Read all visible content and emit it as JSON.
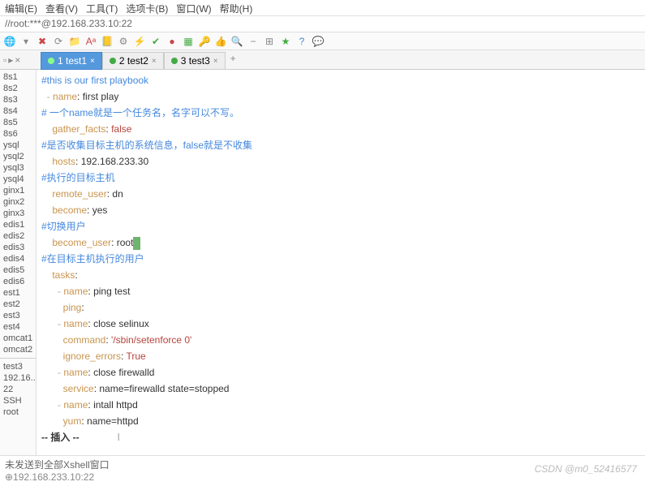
{
  "menubar": [
    "编辑(E)",
    "查看(V)",
    "工具(T)",
    "选项卡(B)",
    "窗口(W)",
    "帮助(H)"
  ],
  "address": "//root:***@192.168.233.10:22",
  "toolbar_icons": [
    {
      "name": "globe-icon",
      "glyph": "🌐",
      "color": "#4a4"
    },
    {
      "name": "dropdown-icon",
      "glyph": "▾",
      "color": "#888"
    },
    {
      "name": "x-icon",
      "glyph": "✖",
      "color": "#c44"
    },
    {
      "name": "refresh-icon",
      "glyph": "⟳",
      "color": "#888"
    },
    {
      "name": "folder-icon",
      "glyph": "📁",
      "color": "#c90"
    },
    {
      "name": "font-icon",
      "glyph": "Aᵃ",
      "color": "#c44"
    },
    {
      "name": "ledger-icon",
      "glyph": "📒",
      "color": "#888"
    },
    {
      "name": "gear-icon",
      "glyph": "⚙",
      "color": "#888"
    },
    {
      "name": "bolt-icon",
      "glyph": "⚡",
      "color": "#c90"
    },
    {
      "name": "check-icon",
      "glyph": "✔",
      "color": "#4a4"
    },
    {
      "name": "circle-icon",
      "glyph": "●",
      "color": "#c44"
    },
    {
      "name": "squares-icon",
      "glyph": "▦",
      "color": "#4a4"
    },
    {
      "name": "key-icon",
      "glyph": "🔑",
      "color": "#c90"
    },
    {
      "name": "thumb-icon",
      "glyph": "👍",
      "color": "#888"
    },
    {
      "name": "search-icon",
      "glyph": "🔍",
      "color": "#888"
    },
    {
      "name": "minus-icon",
      "glyph": "−",
      "color": "#888"
    },
    {
      "name": "grid-icon",
      "glyph": "⊞",
      "color": "#888"
    },
    {
      "name": "star-icon",
      "glyph": "★",
      "color": "#4a4"
    },
    {
      "name": "help-icon",
      "glyph": "?",
      "color": "#48c"
    },
    {
      "name": "chat-icon",
      "glyph": "💬",
      "color": "#888"
    }
  ],
  "tabs": [
    {
      "num": "1",
      "label": "test1",
      "active": true
    },
    {
      "num": "2",
      "label": "test2",
      "active": false
    },
    {
      "num": "3",
      "label": "test3",
      "active": false
    }
  ],
  "sidebar_top": [
    "8s1",
    "8s2",
    "8s3",
    "8s4",
    "8s5",
    "8s6",
    "ysql",
    "ysql2",
    "ysql3",
    "ysql4",
    "ginx1",
    "ginx2",
    "ginx3",
    "edis1",
    "edis2",
    "edis3",
    "edis4",
    "edis5",
    "edis6",
    "est1",
    "est2",
    "est3",
    "est4",
    "omcat1",
    "omcat2"
  ],
  "sidebar_bottom": [
    "test3",
    "192.16...",
    "22",
    "SSH",
    "root"
  ],
  "code": [
    {
      "t": "cm",
      "txt": "#this is our first playbook"
    },
    {
      "pre": "  ",
      "dash": "- ",
      "key": "name",
      "post": ": ",
      "val": "first play"
    },
    {
      "t": "cm",
      "txt": "# 一个name就是一个任务名，名字可以不写。"
    },
    {
      "pre": "    ",
      "key": "gather_facts",
      "post": ": ",
      "bool": "false"
    },
    {
      "t": "cm",
      "txt": "#是否收集目标主机的系统信息，false就是不收集"
    },
    {
      "pre": "    ",
      "key": "hosts",
      "post": ": ",
      "val": "192.168.233.30"
    },
    {
      "t": "cm",
      "txt": "#执行的目标主机"
    },
    {
      "pre": "    ",
      "key": "remote_user",
      "post": ": ",
      "val": "dn"
    },
    {
      "pre": "    ",
      "key": "become",
      "post": ": ",
      "val": "yes"
    },
    {
      "t": "cm",
      "txt": "#切换用户"
    },
    {
      "pre": "    ",
      "key": "become_user",
      "post": ": ",
      "val": "root",
      "cursor": true
    },
    {
      "t": "cm",
      "txt": "#在目标主机执行的用户"
    },
    {
      "pre": "    ",
      "key": "tasks",
      "post": ":"
    },
    {
      "pre": "      ",
      "dash": "- ",
      "key": "name",
      "post": ": ",
      "val": "ping test"
    },
    {
      "pre": "        ",
      "key": "ping",
      "post": ":"
    },
    {
      "pre": "      ",
      "dash": "- ",
      "key": "name",
      "post": ": ",
      "val": "close selinux"
    },
    {
      "pre": "        ",
      "key": "command",
      "post": ": ",
      "str": "'/sbin/setenforce 0'"
    },
    {
      "pre": "        ",
      "key": "ignore_errors",
      "post": ": ",
      "bool": "True"
    },
    {
      "pre": "      ",
      "dash": "- ",
      "key": "name",
      "post": ": ",
      "val": "close firewalld"
    },
    {
      "pre": "        ",
      "key": "service",
      "post": ": ",
      "val": "name=firewalld state=stopped"
    },
    {
      "pre": "      ",
      "dash": "- ",
      "key": "name",
      "post": ": ",
      "val": "intall httpd"
    },
    {
      "pre": "        ",
      "key": "yum",
      "post": ": ",
      "val": "name=httpd"
    },
    {
      "t": "mode",
      "txt": "-- 插入 --",
      "ibeam": true
    }
  ],
  "status_line": "未发送到全部Xshell窗口",
  "bottom_ip": "⊕192.168.233.10:22",
  "watermark": "CSDN @m0_52416577"
}
